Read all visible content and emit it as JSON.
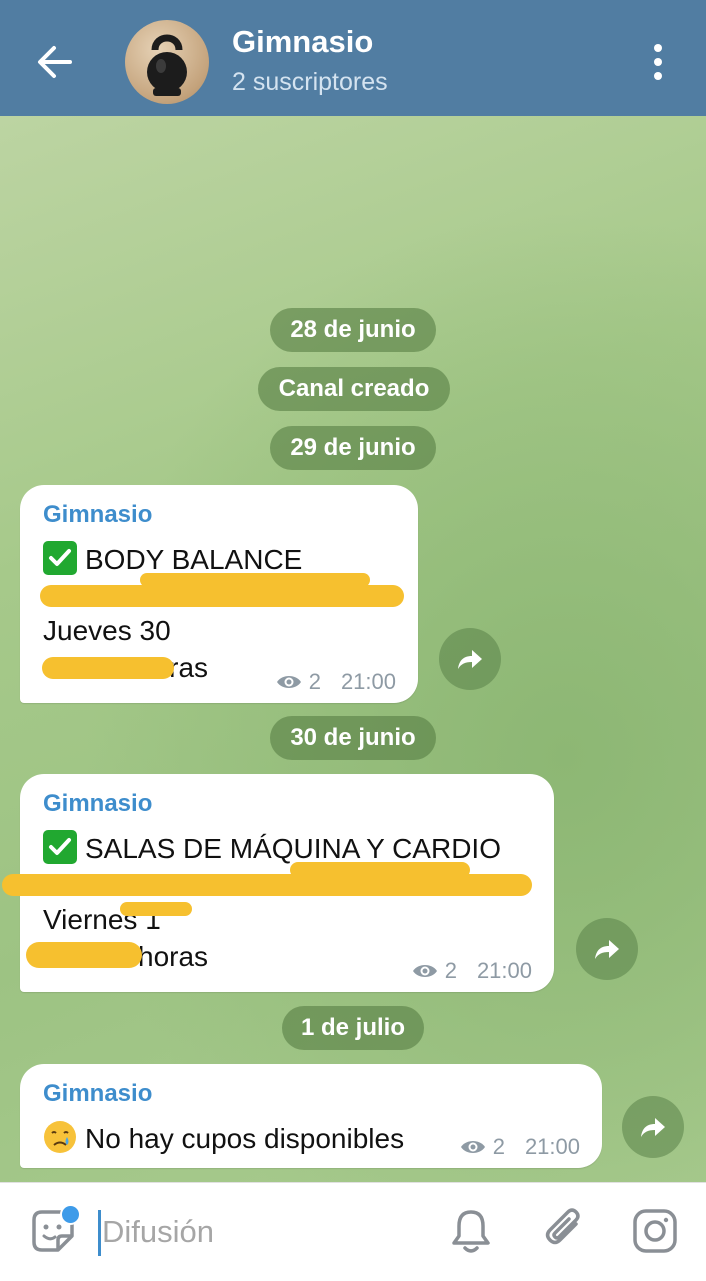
{
  "header": {
    "title": "Gimnasio",
    "subtitle": "2 suscriptores"
  },
  "dates": {
    "d1": "28 de junio",
    "created": "Canal creado",
    "d2": "29 de junio",
    "d3": "30 de junio",
    "d4": "1 de julio"
  },
  "messages": [
    {
      "sender": "Gimnasio",
      "line1": "BODY BALANCE",
      "line2": "Jueves 30",
      "line3": "horas",
      "views": "2",
      "time": "21:00"
    },
    {
      "sender": "Gimnasio",
      "line1": "SALAS DE MÁQUINA Y CARDIO",
      "line2": "Viernes 1",
      "line3": "horas",
      "views": "2",
      "time": "21:00"
    },
    {
      "sender": "Gimnasio",
      "line1": "No hay cupos disponibles",
      "views": "2",
      "time": "21:00"
    }
  ],
  "input": {
    "placeholder": "Difusión"
  },
  "colors": {
    "header": "#517da2",
    "accent": "#3e8dcc"
  }
}
